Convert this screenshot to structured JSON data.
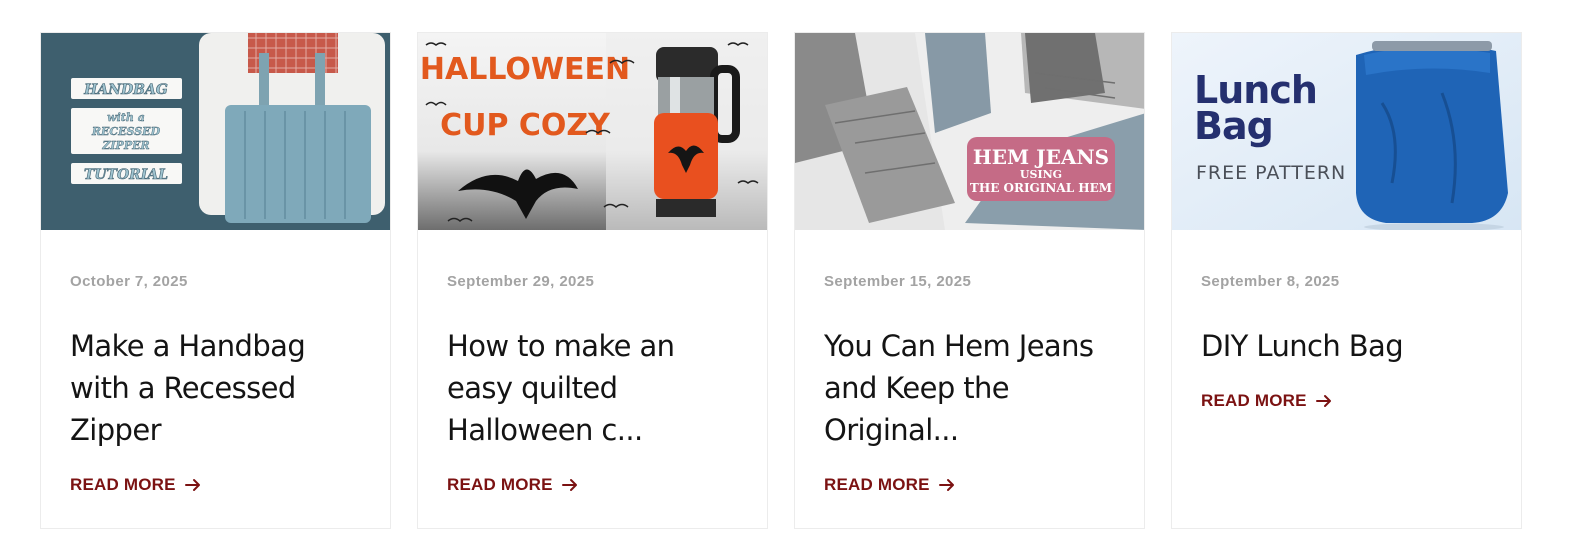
{
  "posts": [
    {
      "date": "October 7, 2025",
      "title": "Make a Handbag with a Recessed Zipper",
      "read_more": "READ MORE",
      "image_text": {
        "line1": "HANDBAG",
        "line2": "with a",
        "line3": "RECESSED",
        "line4": "ZIPPER",
        "line5": "TUTORIAL"
      }
    },
    {
      "date": "September 29, 2025",
      "title": "How to make an easy quilted Halloween c...",
      "read_more": "READ MORE",
      "image_text": {
        "line1": "HALLOWEEN",
        "line2": "CUP COZY"
      }
    },
    {
      "date": "September 15, 2025",
      "title": "You Can Hem Jeans and Keep the Original...",
      "read_more": "READ MORE",
      "image_text": {
        "line1": "HEM JEANS",
        "line2": "USING",
        "line3": "THE ORIGINAL HEM"
      }
    },
    {
      "date": "September 8, 2025",
      "title": "DIY Lunch Bag",
      "read_more": "READ MORE",
      "image_text": {
        "line1": "Lunch",
        "line2": "Bag",
        "line3": "FREE PATTERN"
      }
    }
  ],
  "colors": {
    "accent": "#7b1212",
    "date": "#a3a3a3",
    "title": "#141414",
    "card_border": "#ececec"
  },
  "icons": {
    "read_more": "arrow-right-icon"
  }
}
